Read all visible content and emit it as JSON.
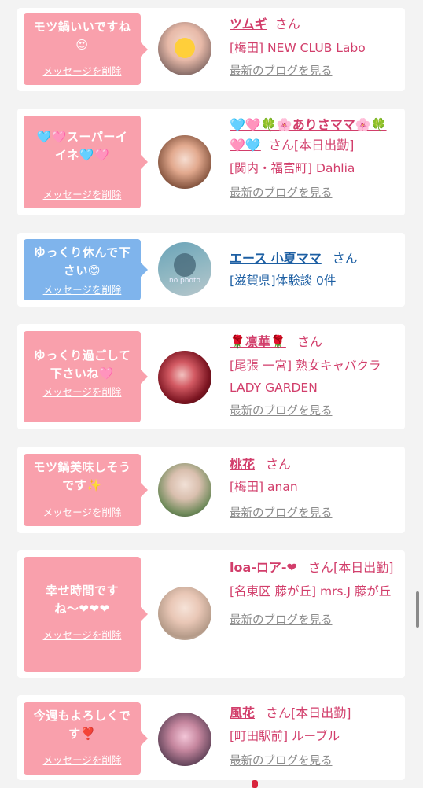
{
  "delete_label": "メッセージを削除",
  "blog_label": "最新のブログを見る",
  "san": "さん",
  "cards": [
    {
      "message": "モツ鍋いいですね😍",
      "name": "ツムギ",
      "status": "",
      "shop": "[梅田] NEW CLUB Labo"
    },
    {
      "message": "🩵🩷スーパーイイネ🩵🩷",
      "name": "🩵🩷🍀🌸ありさママ🌸🍀🩷🩵",
      "status": "[本日出勤]",
      "shop": "[関内・福富町] Dahlia"
    },
    {
      "message": "ゆっくり休んで下さい😊",
      "name": "エース 小夏ママ",
      "status": "",
      "shop": "[滋賀県]体験談 0件",
      "avatar_text": "no photo"
    },
    {
      "message": "ゆっくり過ごして下さいね🩷",
      "name": "🌹凛華🌹",
      "status": "",
      "shop": "[尾張 一宮] 熟女キャバクラ LADY GARDEN"
    },
    {
      "message": "モツ鍋美味しそうです✨",
      "name": "桃花",
      "status": "",
      "shop": "[梅田] anan"
    },
    {
      "message": "幸せ時間ですね〜❤❤❤",
      "name": "loa-ロア-❤",
      "status": "[本日出勤]",
      "shop": "[名東区 藤が丘] mrs.J 藤が丘"
    },
    {
      "message": "今週もよろしくです❣️",
      "name": "風花",
      "status": "[本日出勤]",
      "shop": "[町田駅前] ルーブル"
    }
  ]
}
